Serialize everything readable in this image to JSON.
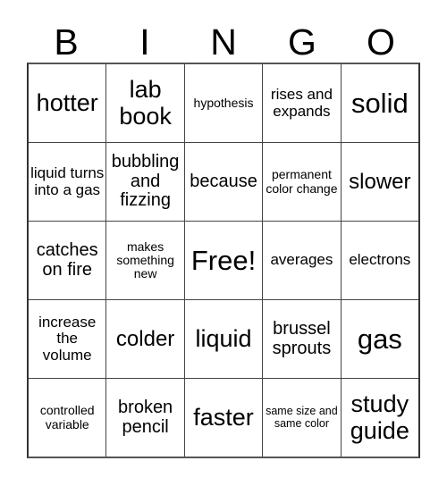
{
  "card": {
    "title": "BINGO",
    "header": [
      "B",
      "I",
      "N",
      "G",
      "O"
    ],
    "free_space_label": "Free!",
    "colors": {
      "background": "#ffffff",
      "text": "#000000",
      "grid_line": "#444444",
      "border": "#333333"
    },
    "grid": {
      "columns": 5,
      "rows": 5,
      "cells": [
        [
          {
            "text": "hotter",
            "size": "xl"
          },
          {
            "text": "lab book",
            "size": "xl"
          },
          {
            "text": "hypothesis",
            "size": "xs"
          },
          {
            "text": "rises and expands",
            "size": "sm"
          },
          {
            "text": "solid",
            "size": "xxl"
          }
        ],
        [
          {
            "text": "liquid turns into a gas",
            "size": "sm"
          },
          {
            "text": "bubbling and fizzing",
            "size": "md"
          },
          {
            "text": "because",
            "size": "md"
          },
          {
            "text": "permanent color change",
            "size": "xs"
          },
          {
            "text": "slower",
            "size": "lg"
          }
        ],
        [
          {
            "text": "catches on fire",
            "size": "md"
          },
          {
            "text": "makes something new",
            "size": "xs"
          },
          {
            "text": "Free!",
            "size": "xxl"
          },
          {
            "text": "averages",
            "size": "sm"
          },
          {
            "text": "electrons",
            "size": "sm"
          }
        ],
        [
          {
            "text": "increase the volume",
            "size": "sm"
          },
          {
            "text": "colder",
            "size": "lg"
          },
          {
            "text": "liquid",
            "size": "xl"
          },
          {
            "text": "brussel sprouts",
            "size": "md"
          },
          {
            "text": "gas",
            "size": "xxl"
          }
        ],
        [
          {
            "text": "controlled variable",
            "size": "xs"
          },
          {
            "text": "broken pencil",
            "size": "md"
          },
          {
            "text": "faster",
            "size": "xl"
          },
          {
            "text": "same size and same color",
            "size": "xxs"
          },
          {
            "text": "study guide",
            "size": "xl"
          }
        ]
      ]
    }
  }
}
